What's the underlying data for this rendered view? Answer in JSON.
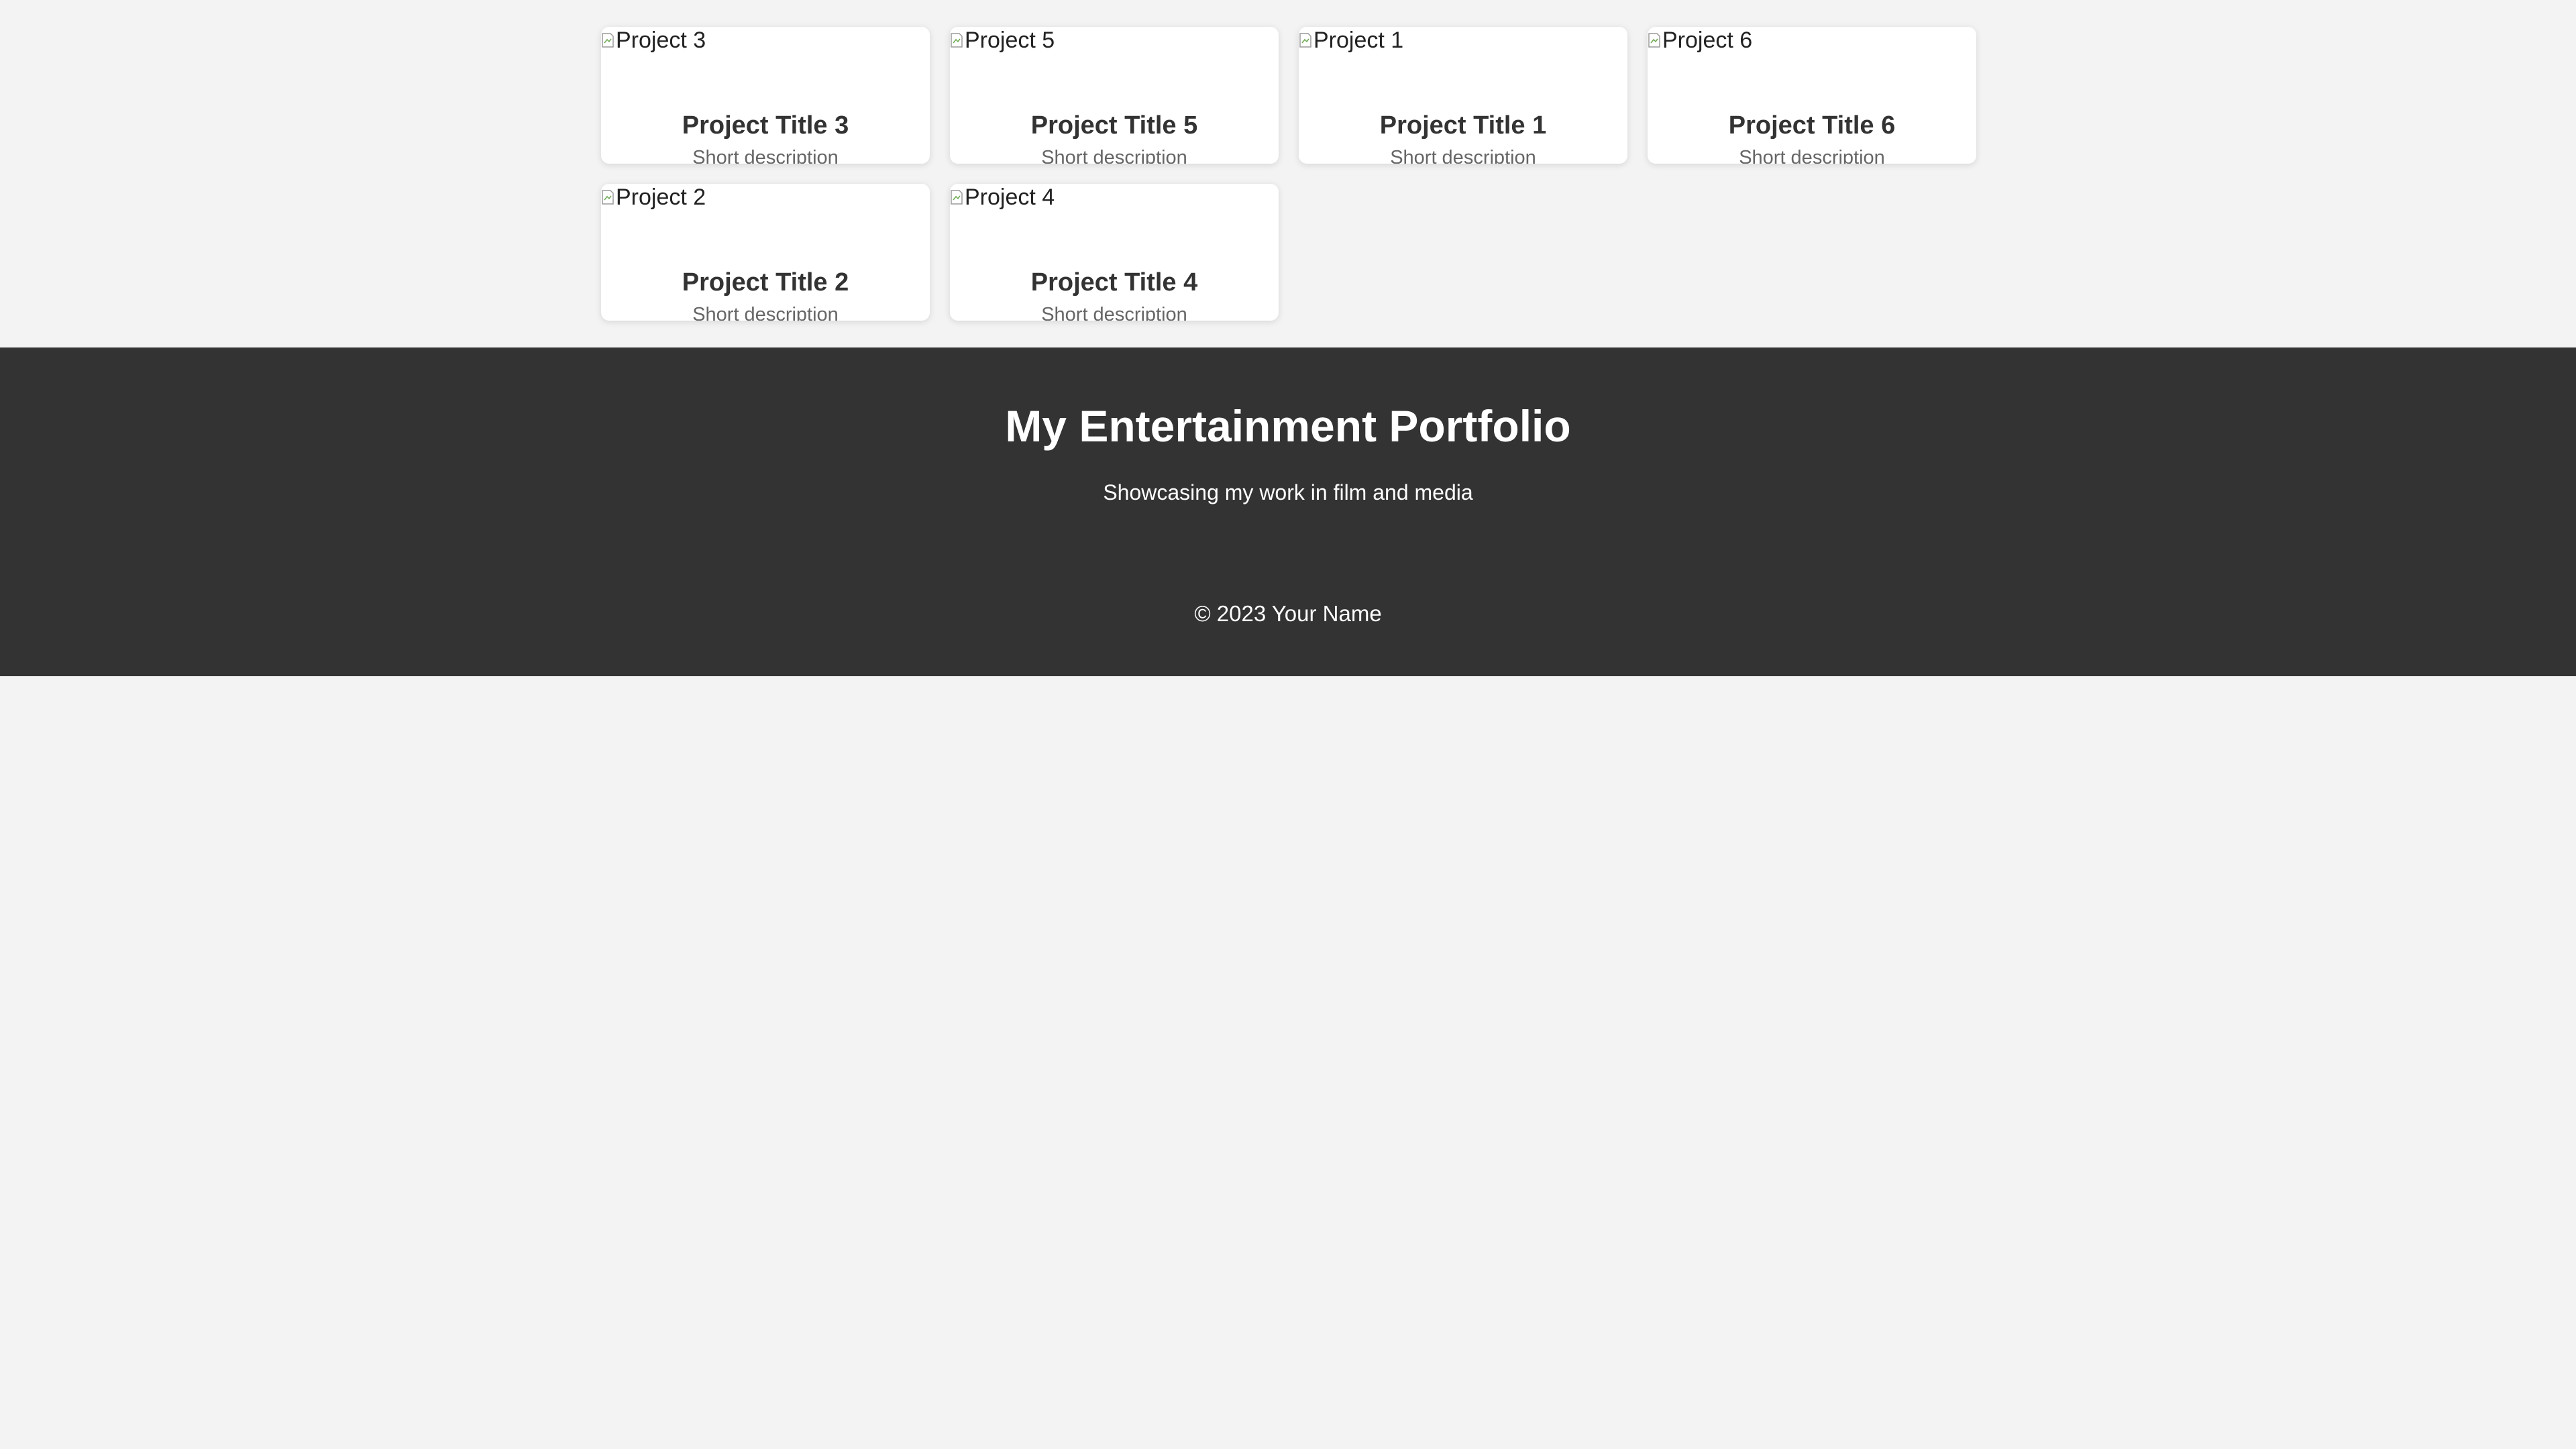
{
  "projects": [
    {
      "alt": "Project 3",
      "title": "Project Title 3",
      "description": "Short description"
    },
    {
      "alt": "Project 5",
      "title": "Project Title 5",
      "description": "Short description"
    },
    {
      "alt": "Project 1",
      "title": "Project Title 1",
      "description": "Short description"
    },
    {
      "alt": "Project 6",
      "title": "Project Title 6",
      "description": "Short description"
    },
    {
      "alt": "Project 2",
      "title": "Project Title 2",
      "description": "Short description"
    },
    {
      "alt": "Project 4",
      "title": "Project Title 4",
      "description": "Short description"
    }
  ],
  "footer": {
    "title": "My Entertainment Portfolio",
    "subtitle": "Showcasing my work in film and media",
    "copyright": "© 2023 Your Name"
  },
  "colors": {
    "background": "#f3f3f3",
    "footer_bg": "#333333",
    "card_bg": "#ffffff",
    "title_text": "#333333",
    "desc_text": "#666666"
  }
}
